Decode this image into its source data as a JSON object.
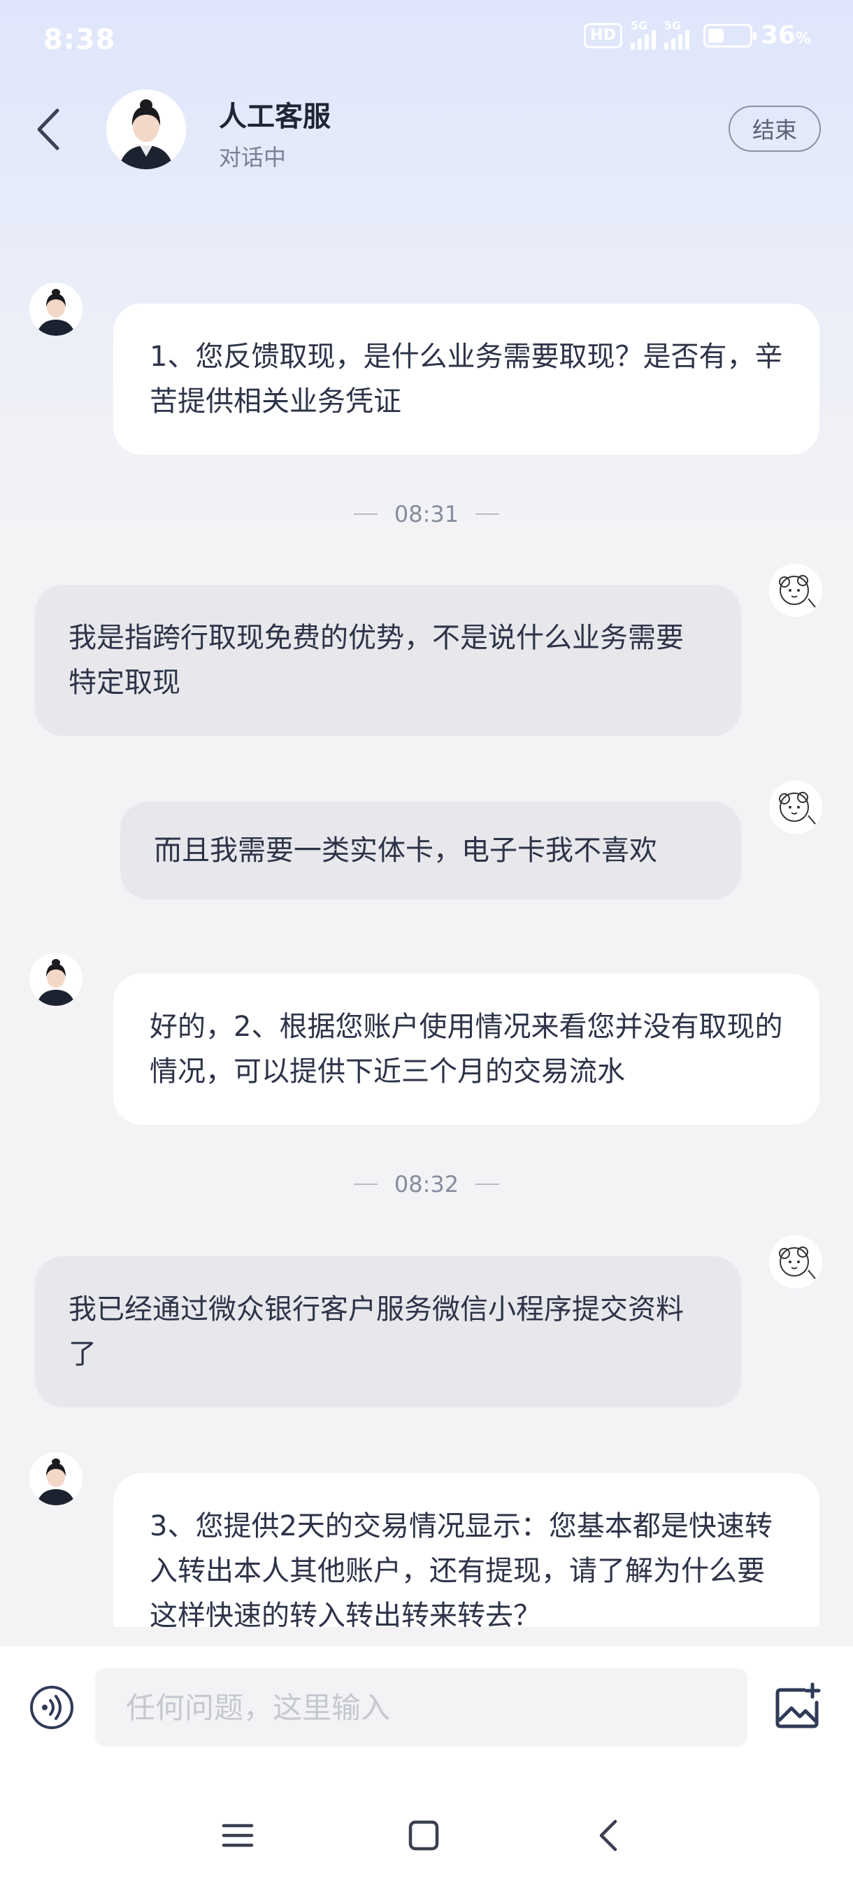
{
  "status_bar": {
    "time": "8:38",
    "hd": "HD",
    "sim1": "5G",
    "sim2": "5G",
    "battery_percent": "36",
    "battery_unit": "%"
  },
  "header": {
    "title": "人工客服",
    "status": "对话中",
    "end_label": "结束"
  },
  "messages": [
    {
      "sender": "agent",
      "text": "1、您反馈取现，是什么业务需要取现？是否有，辛苦提供相关业务凭证"
    },
    {
      "type": "timestamp",
      "text": "08:31"
    },
    {
      "sender": "user",
      "text": "我是指跨行取现免费的优势，不是说什么业务需要特定取现"
    },
    {
      "sender": "user",
      "text": "而且我需要一类实体卡，电子卡我不喜欢"
    },
    {
      "sender": "agent",
      "text": "好的，2、根据您账户使用情况来看您并没有取现的情况，可以提供下近三个月的交易流水"
    },
    {
      "type": "timestamp",
      "text": "08:32"
    },
    {
      "sender": "user",
      "text": "我已经通过微众银行客户服务微信小程序提交资料了"
    },
    {
      "sender": "agent",
      "text": "3、您提供2天的交易情况显示：您基本都是快速转入转出本人其他账户，还有提现，请了解为什么要这样快速的转入转出转来转去？"
    }
  ],
  "input": {
    "placeholder": "任何问题，这里输入"
  },
  "colors": {
    "agent_bubble": "#ffffff",
    "user_bubble": "#e8e8ec",
    "header_gradient_top": "#dfe6fb"
  }
}
